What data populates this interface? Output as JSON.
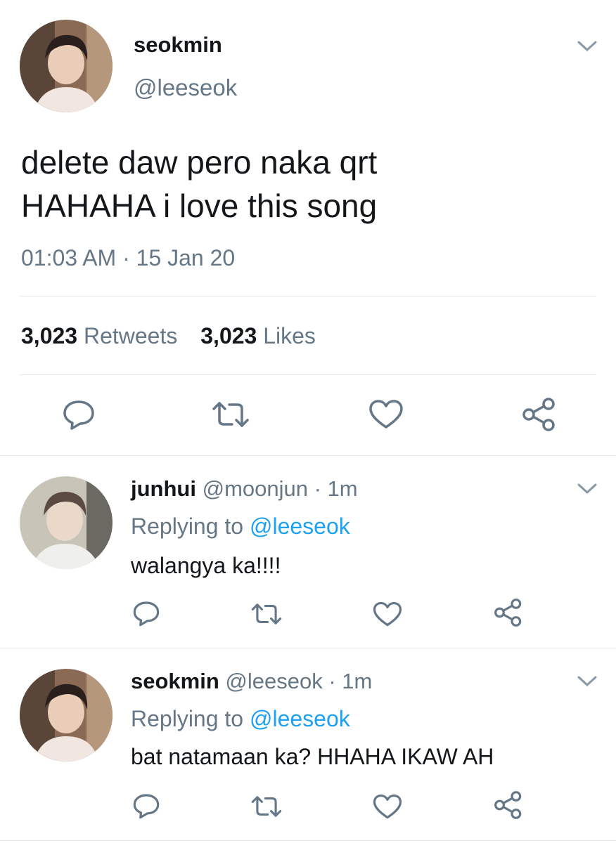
{
  "main_tweet": {
    "display_name": "seokmin",
    "handle": "@leeseok",
    "text_line1": "delete daw pero naka qrt",
    "text_line2": "HAHAHA i love this song",
    "timestamp": "01:03 AM · 15 Jan 20",
    "retweets_count": "3,023",
    "retweets_label": "Retweets",
    "likes_count": "3,023",
    "likes_label": "Likes"
  },
  "replies": [
    {
      "display_name": "junhui",
      "handle": "@moonjun",
      "time": "· 1m",
      "replying_prefix": "Replying to",
      "replying_to": "@leeseok",
      "text": "walangya ka!!!!"
    },
    {
      "display_name": "seokmin",
      "handle": "@leeseok",
      "time": "· 1m",
      "replying_prefix": "Replying to",
      "replying_to": "@leeseok",
      "text": "bat natamaan ka? HHAHA IKAW AH"
    }
  ],
  "icons": [
    "chevron-down-icon",
    "reply-icon",
    "retweet-icon",
    "like-icon",
    "share-icon"
  ],
  "colors": {
    "link": "#1da1f2",
    "muted": "#657786",
    "divider": "#e1e8ed",
    "text": "#14171a"
  }
}
